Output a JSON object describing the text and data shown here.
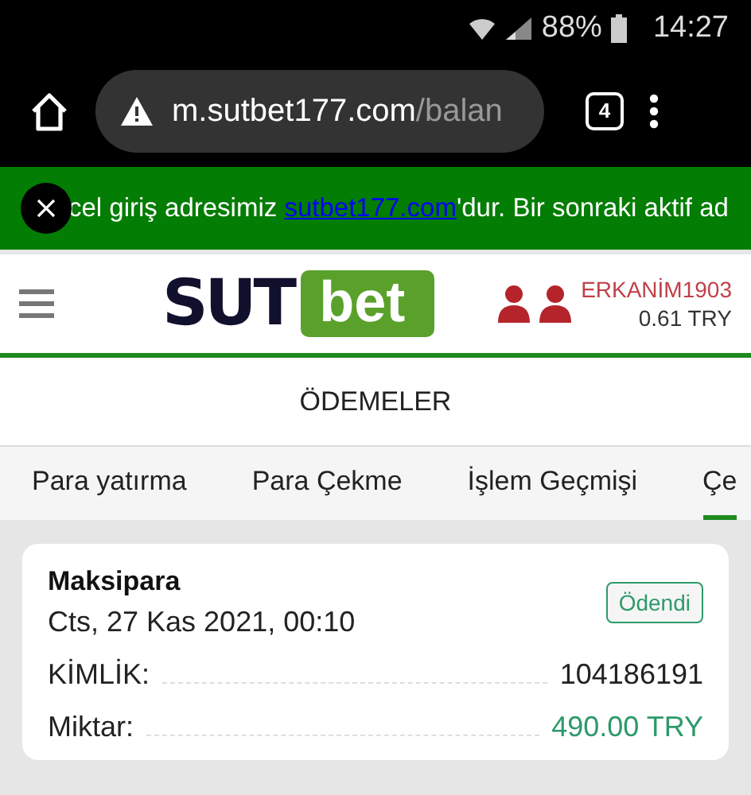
{
  "status_bar": {
    "battery": "88%",
    "time": "14:27"
  },
  "browser": {
    "url_host": "m.sutbet177.com",
    "url_path": "/balan",
    "tab_count": "4"
  },
  "banner": {
    "text_before": "cel giriş adresimiz ",
    "link": "sutbet177.com",
    "text_after": "'dur. Bir sonraki aktif ad"
  },
  "header": {
    "logo_left": "SUT",
    "logo_right": "bet",
    "username": "ERKANİM1903",
    "balance": "0.61 TRY"
  },
  "page_title": "ÖDEMELER",
  "tabs": [
    {
      "label": "Para yatırma",
      "selected": false
    },
    {
      "label": "Para Çekme",
      "selected": false
    },
    {
      "label": "İşlem Geçmişi",
      "selected": false
    },
    {
      "label": "Çe",
      "selected": true
    }
  ],
  "payments": [
    {
      "method": "Maksipara",
      "date": "Cts, 27 Kas 2021, 00:10",
      "status": "Ödendi",
      "rows": [
        {
          "label": "KİMLİK:",
          "value": "104186191",
          "kind": "plain"
        },
        {
          "label": "Miktar:",
          "value": "490.00 TRY",
          "kind": "amount"
        }
      ]
    }
  ]
}
